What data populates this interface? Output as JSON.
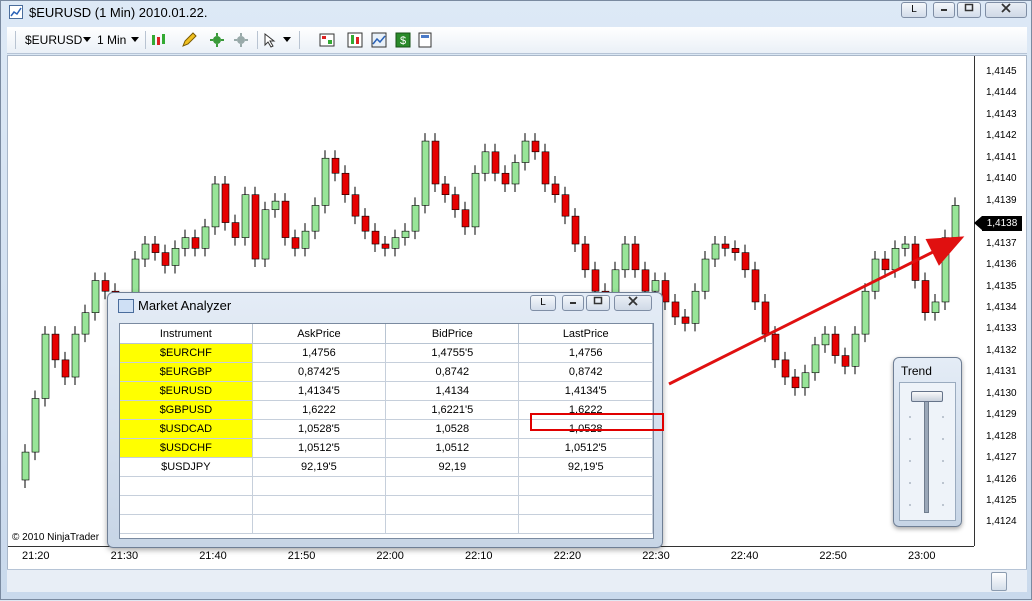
{
  "window": {
    "title": "$EURUSD (1 Min)  2010.01.22.",
    "controls": {
      "link": "L",
      "minimize": "minimize",
      "maximize": "maximize",
      "close": "close"
    }
  },
  "toolbar": {
    "instrument": "$EURUSD",
    "interval": "1 Min",
    "icons": [
      "bar-type-icon",
      "drawing-pencil-icon",
      "add-indicator-icon",
      "strategy-icon",
      "cursor-icon",
      "data-box-icon",
      "properties-icon",
      "chart-trader-icon",
      "dollar-icon",
      "display-icon"
    ]
  },
  "chart": {
    "y_axis_labels": [
      "1,4145",
      "1,4144",
      "1,4143",
      "1,4142",
      "1,4141",
      "1,4140",
      "1,4139",
      "1,4138",
      "1,4137",
      "1,4136",
      "1,4135",
      "1,4134",
      "1,4133",
      "1,4132",
      "1,4131",
      "1,4130",
      "1,4129",
      "1,4128",
      "1,4127",
      "1,4126",
      "1,4125",
      "1,4124"
    ],
    "x_axis_labels": [
      "21:20",
      "21:30",
      "21:40",
      "21:50",
      "22:00",
      "22:10",
      "22:20",
      "22:30",
      "22:40",
      "22:50",
      "23:00"
    ],
    "current_price": "1,4138",
    "copyright": "© 2010 NinjaTrader",
    "colors": {
      "up": "#98e598",
      "down": "#e60000",
      "wick": "#000000",
      "arrow": "#e01010"
    }
  },
  "market_analyzer": {
    "title": "Market Analyzer",
    "link": "L",
    "columns": [
      "Instrument",
      "AskPrice",
      "BidPrice",
      "LastPrice"
    ],
    "rows": [
      {
        "instrument": "$EURCHF",
        "ask": "1,4756",
        "bid": "1,4755'5",
        "last": "1,4756",
        "highlight": true
      },
      {
        "instrument": "$EURGBP",
        "ask": "0,8742'5",
        "bid": "0,8742",
        "last": "0,8742",
        "highlight": true
      },
      {
        "instrument": "$EURUSD",
        "ask": "1,4134'5",
        "bid": "1,4134",
        "last": "1,4134'5",
        "highlight": true
      },
      {
        "instrument": "$GBPUSD",
        "ask": "1,6222",
        "bid": "1,6221'5",
        "last": "1,6222",
        "highlight": true
      },
      {
        "instrument": "$USDCAD",
        "ask": "1,0528'5",
        "bid": "1,0528",
        "last": "1,0528",
        "highlight": true
      },
      {
        "instrument": "$USDCHF",
        "ask": "1,0512'5",
        "bid": "1,0512",
        "last": "1,0512'5",
        "highlight": true
      },
      {
        "instrument": "$USDJPY",
        "ask": "92,19'5",
        "bid": "92,19",
        "last": "92,19'5",
        "highlight": false
      }
    ],
    "highlight_color": "#ffff00"
  },
  "trend": {
    "title": "Trend"
  }
}
